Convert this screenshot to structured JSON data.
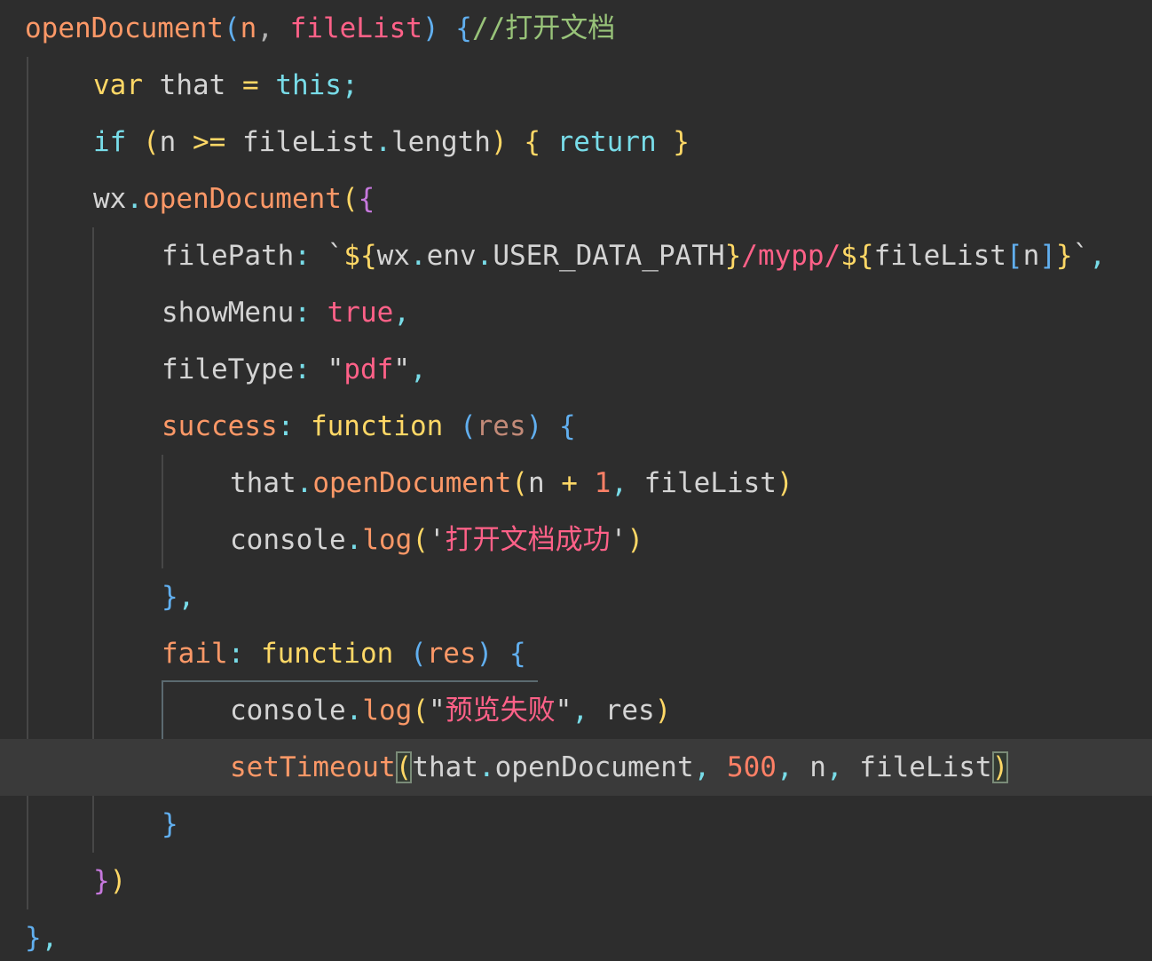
{
  "editor": {
    "lines": [
      {
        "tokens": [
          {
            "text": "openDocument",
            "c": "t-fn"
          },
          {
            "text": "(",
            "c": "t-blue"
          },
          {
            "text": "n",
            "c": "t-param"
          },
          {
            "text": ", ",
            "c": "t-punct"
          },
          {
            "text": "fileList",
            "c": "t-str"
          },
          {
            "text": ") ",
            "c": "t-blue"
          },
          {
            "text": "{",
            "c": "t-blue"
          },
          {
            "text": "//打开文档",
            "c": "t-comment"
          }
        ]
      },
      {
        "tokens": [
          {
            "text": "var",
            "c": "t-kw"
          },
          {
            "text": " that ",
            "c": "t-plain"
          },
          {
            "text": "=",
            "c": "t-kw"
          },
          {
            "text": " this",
            "c": "t-kw2"
          },
          {
            "text": ";",
            "c": "t-kw2"
          }
        ]
      },
      {
        "tokens": [
          {
            "text": "if",
            "c": "t-kw2"
          },
          {
            "text": " ",
            "c": "t-plain"
          },
          {
            "text": "(",
            "c": "t-brace-y"
          },
          {
            "text": "n ",
            "c": "t-plain"
          },
          {
            "text": ">=",
            "c": "t-kw"
          },
          {
            "text": " fileList",
            "c": "t-plain"
          },
          {
            "text": ".",
            "c": "t-kw2"
          },
          {
            "text": "length",
            "c": "t-plain"
          },
          {
            "text": ")",
            "c": "t-brace-y"
          },
          {
            "text": " ",
            "c": "t-plain"
          },
          {
            "text": "{",
            "c": "t-brace-y"
          },
          {
            "text": " return ",
            "c": "t-kw2"
          },
          {
            "text": "}",
            "c": "t-brace-y"
          }
        ]
      },
      {
        "tokens": [
          {
            "text": "wx",
            "c": "t-plain"
          },
          {
            "text": ".",
            "c": "t-kw2"
          },
          {
            "text": "openDocument",
            "c": "t-fn"
          },
          {
            "text": "(",
            "c": "t-brace-y"
          },
          {
            "text": "{",
            "c": "t-brace-p"
          }
        ]
      },
      {
        "tokens": [
          {
            "text": "filePath",
            "c": "t-plain"
          },
          {
            "text": ": ",
            "c": "t-kw2"
          },
          {
            "text": "`",
            "c": "t-plain"
          },
          {
            "text": "${",
            "c": "t-tmpl"
          },
          {
            "text": "wx",
            "c": "t-plain"
          },
          {
            "text": ".",
            "c": "t-kw2"
          },
          {
            "text": "env",
            "c": "t-plain"
          },
          {
            "text": ".",
            "c": "t-kw2"
          },
          {
            "text": "USER_DATA_PATH",
            "c": "t-plain"
          },
          {
            "text": "}",
            "c": "t-tmpl"
          },
          {
            "text": "/mypp/",
            "c": "t-str"
          },
          {
            "text": "${",
            "c": "t-tmpl"
          },
          {
            "text": "fileList",
            "c": "t-plain"
          },
          {
            "text": "[",
            "c": "t-blue"
          },
          {
            "text": "n",
            "c": "t-plain"
          },
          {
            "text": "]",
            "c": "t-blue"
          },
          {
            "text": "}",
            "c": "t-tmpl"
          },
          {
            "text": "`",
            "c": "t-plain"
          },
          {
            "text": ",",
            "c": "t-kw2"
          }
        ]
      },
      {
        "tokens": [
          {
            "text": "showMenu",
            "c": "t-plain"
          },
          {
            "text": ": ",
            "c": "t-kw2"
          },
          {
            "text": "true",
            "c": "t-bool"
          },
          {
            "text": ",",
            "c": "t-kw2"
          }
        ]
      },
      {
        "tokens": [
          {
            "text": "fileType",
            "c": "t-plain"
          },
          {
            "text": ": ",
            "c": "t-kw2"
          },
          {
            "text": "\"",
            "c": "t-plain"
          },
          {
            "text": "pdf",
            "c": "t-str"
          },
          {
            "text": "\"",
            "c": "t-plain"
          },
          {
            "text": ",",
            "c": "t-kw2"
          }
        ]
      },
      {
        "tokens": [
          {
            "text": "success",
            "c": "t-fn"
          },
          {
            "text": ": ",
            "c": "t-kw2"
          },
          {
            "text": "function",
            "c": "t-kw"
          },
          {
            "text": " ",
            "c": "t-plain"
          },
          {
            "text": "(",
            "c": "t-blue"
          },
          {
            "text": "res",
            "c": "t-res"
          },
          {
            "text": ") ",
            "c": "t-blue"
          },
          {
            "text": "{",
            "c": "t-blue"
          }
        ]
      },
      {
        "tokens": [
          {
            "text": "that",
            "c": "t-plain"
          },
          {
            "text": ".",
            "c": "t-kw2"
          },
          {
            "text": "openDocument",
            "c": "t-fn"
          },
          {
            "text": "(",
            "c": "t-brace-y"
          },
          {
            "text": "n ",
            "c": "t-plain"
          },
          {
            "text": "+",
            "c": "t-kw"
          },
          {
            "text": " ",
            "c": "t-plain"
          },
          {
            "text": "1",
            "c": "t-num"
          },
          {
            "text": ",",
            "c": "t-kw2"
          },
          {
            "text": " fileList",
            "c": "t-plain"
          },
          {
            "text": ")",
            "c": "t-brace-y"
          }
        ]
      },
      {
        "tokens": [
          {
            "text": "console",
            "c": "t-plain"
          },
          {
            "text": ".",
            "c": "t-kw2"
          },
          {
            "text": "log",
            "c": "t-fn"
          },
          {
            "text": "(",
            "c": "t-brace-y"
          },
          {
            "text": "'",
            "c": "t-plain"
          },
          {
            "text": "打开文档成功",
            "c": "t-str"
          },
          {
            "text": "'",
            "c": "t-plain"
          },
          {
            "text": ")",
            "c": "t-brace-y"
          }
        ]
      },
      {
        "tokens": [
          {
            "text": "}",
            "c": "t-blue"
          },
          {
            "text": ",",
            "c": "t-kw2"
          }
        ]
      },
      {
        "tokens": [
          {
            "text": "fail",
            "c": "t-fn"
          },
          {
            "text": ": ",
            "c": "t-kw2"
          },
          {
            "text": "function",
            "c": "t-kw"
          },
          {
            "text": " ",
            "c": "t-plain"
          },
          {
            "text": "(",
            "c": "t-blue"
          },
          {
            "text": "res",
            "c": "t-fn"
          },
          {
            "text": ") ",
            "c": "t-blue"
          },
          {
            "text": "{",
            "c": "t-blue"
          }
        ]
      },
      {
        "tokens": [
          {
            "text": "console",
            "c": "t-plain"
          },
          {
            "text": ".",
            "c": "t-kw2"
          },
          {
            "text": "log",
            "c": "t-fn"
          },
          {
            "text": "(",
            "c": "t-brace-y"
          },
          {
            "text": "\"",
            "c": "t-plain"
          },
          {
            "text": "预览失败",
            "c": "t-str"
          },
          {
            "text": "\"",
            "c": "t-plain"
          },
          {
            "text": ",",
            "c": "t-kw2"
          },
          {
            "text": " res",
            "c": "t-plain"
          },
          {
            "text": ")",
            "c": "t-brace-y"
          }
        ]
      },
      {
        "tokens": [
          {
            "text": "setTimeout",
            "c": "t-fn"
          },
          {
            "text": "(",
            "c": "t-brace-y",
            "match": true
          },
          {
            "text": "that",
            "c": "t-plain"
          },
          {
            "text": ".",
            "c": "t-kw2"
          },
          {
            "text": "openDocument",
            "c": "t-plain"
          },
          {
            "text": ",",
            "c": "t-kw2"
          },
          {
            "text": " ",
            "c": "t-plain"
          },
          {
            "text": "500",
            "c": "t-num"
          },
          {
            "text": ",",
            "c": "t-kw2"
          },
          {
            "text": " n",
            "c": "t-plain"
          },
          {
            "text": ",",
            "c": "t-kw2"
          },
          {
            "text": " fileList",
            "c": "t-plain"
          },
          {
            "text": ")",
            "c": "t-brace-y",
            "match": true
          }
        ]
      },
      {
        "tokens": [
          {
            "text": "}",
            "c": "t-blue"
          }
        ]
      },
      {
        "tokens": [
          {
            "text": "}",
            "c": "t-brace-p"
          },
          {
            "text": ")",
            "c": "t-brace-y"
          }
        ]
      },
      {
        "tokens": [
          {
            "text": "}",
            "c": "t-blue"
          },
          {
            "text": ",",
            "c": "t-kw2"
          }
        ]
      }
    ]
  }
}
